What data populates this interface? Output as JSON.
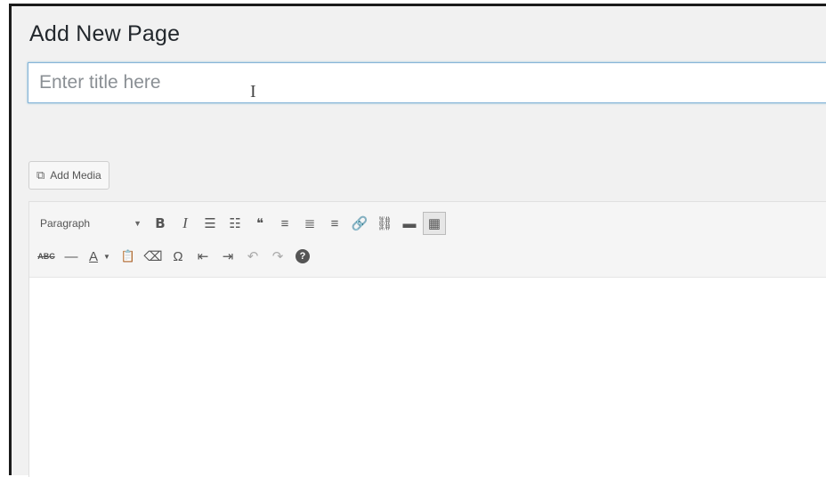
{
  "page": {
    "title": "Add New Page"
  },
  "title_field": {
    "placeholder": "Enter title here",
    "value": ""
  },
  "media": {
    "label": "Add Media",
    "icon": "media-icon"
  },
  "toolbar": {
    "format_select": {
      "selected": "Paragraph"
    },
    "row1": [
      {
        "name": "bold",
        "glyph": "B"
      },
      {
        "name": "italic",
        "glyph": "I"
      },
      {
        "name": "bulleted-list",
        "glyph": "☰"
      },
      {
        "name": "numbered-list",
        "glyph": "☷"
      },
      {
        "name": "blockquote",
        "glyph": "❝"
      },
      {
        "name": "align-left",
        "glyph": "≡"
      },
      {
        "name": "align-center",
        "glyph": "≣"
      },
      {
        "name": "align-right",
        "glyph": "≡"
      },
      {
        "name": "insert-link",
        "glyph": "🔗"
      },
      {
        "name": "remove-link",
        "glyph": "⛓"
      },
      {
        "name": "read-more",
        "glyph": "▬"
      },
      {
        "name": "toolbar-toggle",
        "glyph": "▦"
      }
    ],
    "row2": [
      {
        "name": "strikethrough",
        "glyph": "ABC"
      },
      {
        "name": "horizontal-line",
        "glyph": "—"
      },
      {
        "name": "text-color",
        "glyph": "A"
      },
      {
        "name": "paste-as-text",
        "glyph": "📋"
      },
      {
        "name": "clear-formatting",
        "glyph": "⌫"
      },
      {
        "name": "special-character",
        "glyph": "Ω"
      },
      {
        "name": "decrease-indent",
        "glyph": "⇤"
      },
      {
        "name": "increase-indent",
        "glyph": "⇥"
      },
      {
        "name": "undo",
        "glyph": "↶"
      },
      {
        "name": "redo",
        "glyph": "↷"
      },
      {
        "name": "help",
        "glyph": "?"
      }
    ]
  },
  "colors": {
    "accent_focus": "#86b4d8",
    "background": "#f1f1f1"
  }
}
